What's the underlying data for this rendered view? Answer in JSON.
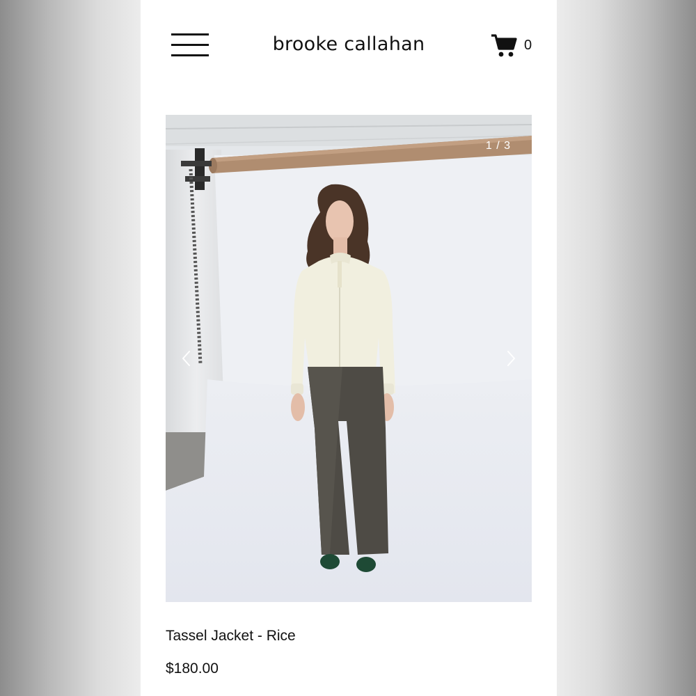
{
  "header": {
    "brand": "brooke callahan",
    "cart_count": "0",
    "menu_icon": "hamburger-menu-icon",
    "cart_icon": "shopping-cart-icon"
  },
  "gallery": {
    "counter": "1 / 3",
    "current_index": 1,
    "total": 3,
    "prev_icon": "chevron-left-icon",
    "next_icon": "chevron-right-icon"
  },
  "product": {
    "title": "Tassel Jacket - Rice",
    "price": "$180.00"
  },
  "colors": {
    "text": "#111111",
    "background": "#ffffff"
  }
}
